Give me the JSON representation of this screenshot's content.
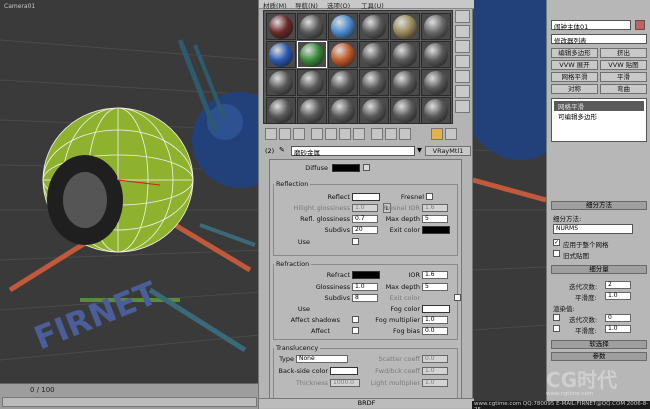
{
  "viewport": {
    "label": "Camera01",
    "time_text": "0 / 100",
    "text_object": "FIRNET"
  },
  "material_editor": {
    "menu": [
      "材质(M)",
      "导航(N)",
      "选项(O)",
      "工具(U)"
    ],
    "material_id": "(2)",
    "material_name": "磨砂金属",
    "material_type": "VRayMtl1",
    "diffuse_label": "Diffuse",
    "reflection": {
      "title": "Reflection",
      "reflect_label": "Reflect",
      "hilight_label": "Hilight glossiness",
      "hilight_val": "1.0",
      "refl_gloss_label": "Refl. glossiness",
      "refl_gloss_val": "0.7",
      "subdivs_label": "Subdivs",
      "subdivs_val": "20",
      "use_label": "Use",
      "fresnel_label": "Fresnel",
      "fresnel_ior_label": "Fresnel IOR",
      "fresnel_ior_val": "1.6",
      "max_depth_label": "Max depth",
      "max_depth_val": "5",
      "exit_label": "Exit color",
      "l_label": "L"
    },
    "refraction": {
      "title": "Refraction",
      "refract_label": "Refract",
      "ior_label": "IOR",
      "ior_val": "1.6",
      "gloss_label": "Glossiness",
      "gloss_val": "1.0",
      "max_depth_label": "Max depth",
      "max_depth_val": "5",
      "subdivs_label": "Subdivs",
      "subdivs_val": "8",
      "exit_label": "Exit color",
      "use_label": "Use",
      "fog_color_label": "Fog color",
      "affect_shadows_label": "Affect shadows",
      "fog_mult_label": "Fog multiplier",
      "fog_mult_val": "1.0",
      "affect_label": "Affect",
      "fog_bias_label": "Fog bias",
      "fog_bias_val": "0.0"
    },
    "translucency": {
      "title": "Translucency",
      "type_label": "Type",
      "type_val": "None",
      "scatter_label": "Scatter coeff",
      "scatter_val": "0.0",
      "backside_label": "Back-side color",
      "fwdbck_label": "Fwd/bck coeff",
      "fwdbck_val": "1.0",
      "thickness_label": "Thickness",
      "thickness_val": "1000.0",
      "light_mult_label": "Light multiplier",
      "light_mult_val": "1.0"
    },
    "brdf_label": "BRDF"
  },
  "command_panel": {
    "object_name": "闹钟主体01",
    "modifier_list": "修改器列表",
    "buttons": [
      "编辑多边形",
      "挤出",
      "VVW 展开",
      "VVW 贴图",
      "网格平滑",
      "平滑",
      "对称",
      "弯曲"
    ],
    "stack_items": [
      "网格平滑",
      "可编辑多边形"
    ],
    "subdiv_method_hdr": "细分方法",
    "subdiv_method_label": "细分方法:",
    "subdiv_method_val": "NURMS",
    "apply_whole_label": "应用于整个网格",
    "old_map_label": "旧式贴图",
    "subdiv_amount_hdr": "细分量",
    "iterations_label": "迭代次数:",
    "iterations_val": "2",
    "smoothness_label": "平滑度:",
    "smoothness_val": "1.0",
    "render_label": "渲染值:",
    "r_iterations_val": "0",
    "r_smoothness_val": "1.0",
    "soft_sel_hdr": "软选择",
    "params_hdr": "参数"
  },
  "watermark": {
    "brand": "CG时代",
    "url": "www.cgtime.com"
  },
  "footer": {
    "text": "www.cgtime.com   QQ:780095  E-MAIL:FIRNET@QQ.COM   2006-8-25"
  }
}
